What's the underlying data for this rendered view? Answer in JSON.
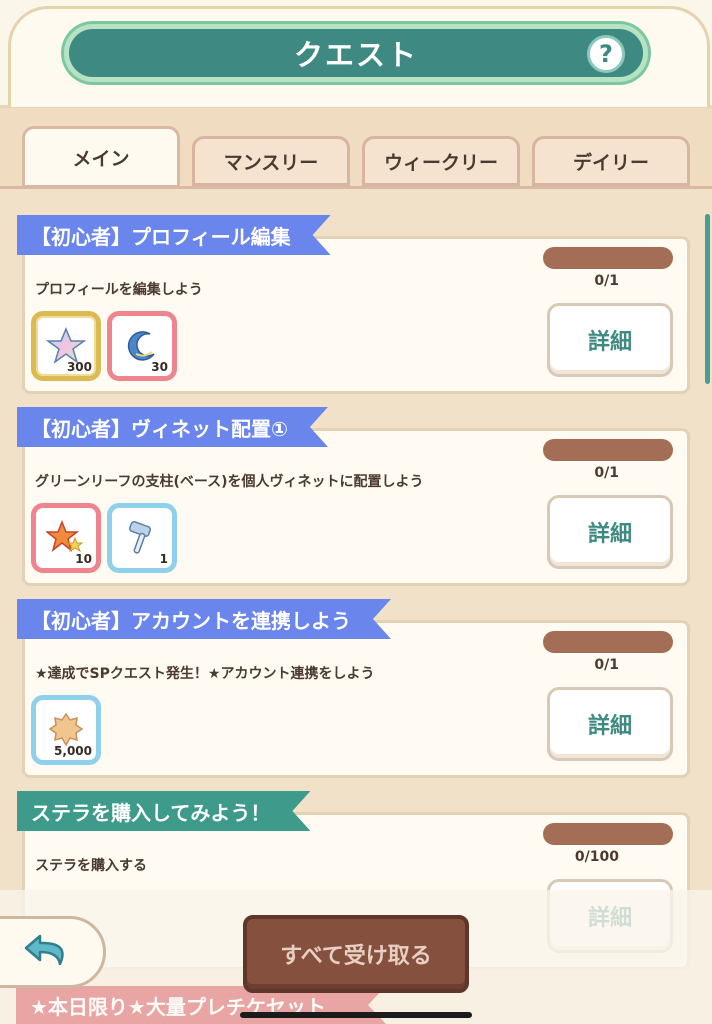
{
  "header": {
    "title": "クエスト",
    "help_label": "?"
  },
  "tabs": [
    {
      "label": "メイン",
      "active": true
    },
    {
      "label": "マンスリー",
      "active": false
    },
    {
      "label": "ウィークリー",
      "active": false
    },
    {
      "label": "デイリー",
      "active": false
    }
  ],
  "quests": [
    {
      "title": "【初心者】プロフィール編集",
      "ribbon_color": "#6a85ec",
      "description": "プロフィールを編集しよう",
      "progress": "0/1",
      "detail_label": "詳細",
      "rewards": [
        {
          "icon": "star-crystal-icon",
          "qty": "300",
          "frame": "gold"
        },
        {
          "icon": "moon-icon",
          "qty": "30",
          "frame": "pink"
        }
      ]
    },
    {
      "title": "【初心者】ヴィネット配置①",
      "ribbon_color": "#6a85ec",
      "description": "グリーンリーフの支柱(ベース)を個人ヴィネットに配置しよう",
      "progress": "0/1",
      "detail_label": "詳細",
      "rewards": [
        {
          "icon": "double-star-icon",
          "qty": "10",
          "frame": "pink"
        },
        {
          "icon": "hammer-icon",
          "qty": "1",
          "frame": "blue"
        }
      ]
    },
    {
      "title": "【初心者】アカウントを連携しよう",
      "ribbon_color": "#6a85ec",
      "description": "★達成でSPクエスト発生！★アカウント連携をしよう",
      "progress": "0/1",
      "detail_label": "詳細",
      "rewards": [
        {
          "icon": "coin-icon",
          "qty": "5,000",
          "frame": "blue"
        }
      ]
    },
    {
      "title": "ステラを購入してみよう！",
      "ribbon_color": "#3e9a8a",
      "description": "ステラを購入する",
      "progress": "0/100",
      "detail_label": "詳細",
      "rewards": []
    }
  ],
  "next_quest_title": "★本日限り★大量プレチケセット",
  "footer": {
    "collect_all_label": "すべて受け取る",
    "back_icon": "back-arrow-icon"
  }
}
